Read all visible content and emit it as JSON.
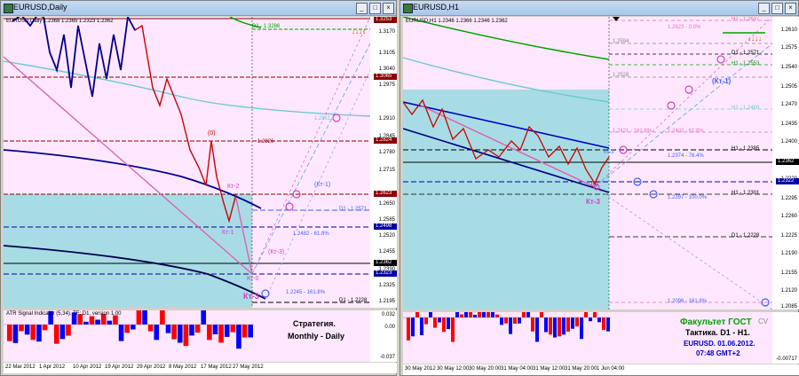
{
  "left_window": {
    "title": "EURUSD,Daily",
    "ohlc_label": "EURUSD,Daily  1.2368 1.2365 1.2323 1.2362",
    "price_ticks": [
      "1.3253",
      "1.3170",
      "1.3105",
      "1.3040",
      "1.2975",
      "1.2910",
      "1.2845",
      "1.2780",
      "1.2715",
      "1.2650",
      "1.2585",
      "1.2520",
      "1.2455",
      "1.2390",
      "1.2325",
      "1.2260",
      "1.2195"
    ],
    "price_boxes": {
      "top": "1.3253",
      "mid1": "1.3065",
      "mid2": "1.2824",
      "mid3": "1.2623",
      "blue1": "1.2498",
      "black": "1.2362",
      "bottom": "1.2323"
    },
    "labels": {
      "d1_top": "D1 - 1.3286",
      "d1_2571": "D1 - 1.2571",
      "d1_2228": "D1 - 1.2228",
      "fib_2482": "1.2482 - 61.8%",
      "fib_2245": "1.2245 - 161.8%",
      "lvl_1_2826": "1.2826",
      "lvl_1_2951": "1.2951",
      "zero": "(0)",
      "kt2": "Кт-2",
      "kt1": "Кт-1",
      "kt3": "(Кт-3)",
      "kt1b": "(Кт-1)",
      "kt0": "Кт-0",
      "kt3big": "Кт-3"
    },
    "indicator_label": "ATR Signal Indicator (5,34). TF: D1, version 1.00",
    "indicator_ticks": [
      "0.032",
      "0.00",
      "-0.037"
    ],
    "strategy_line1": "Стратегия.",
    "strategy_line2": "Monthly - Daily",
    "time_ticks": [
      "22 Mar 2012",
      "1 Apr 2012",
      "10 Apr 2012",
      "19 Apr 2012",
      "29 Apr 2012",
      "8 May 2012",
      "17 May 2012",
      "27 May 2012"
    ]
  },
  "right_window": {
    "title": "EURUSD,H1",
    "ohlc_label": "EURUSD,H1  1.2346 1.2366 1.2346 1.2362",
    "price_ticks": [
      "1.2610",
      "1.2575",
      "1.2540",
      "1.2505",
      "1.2470",
      "1.2435",
      "1.2400",
      "1.2365",
      "1.2330",
      "1.2295",
      "1.2260",
      "1.2225",
      "1.2190",
      "1.2155",
      "1.2120",
      "1.2085"
    ],
    "price_boxes": {
      "black": "1.2362",
      "blue": "1.2322"
    },
    "labels": {
      "h1_2637": "H1 - 1.2637",
      "fib_2623": "1.2623 - 0.0%",
      "lvl_2594": "1.2594",
      "d1_2571": "D1 - 1.2571",
      "h1_2553": "H1 - 1.2553",
      "lvl_2528": "1.2528",
      "h1_2469": "H1 - 1.2469",
      "fib_2421": "1.2421 - 161.8%",
      "fib_2402": "1.2402 - 61.8%",
      "h1_2385": "H1 - 1.2385",
      "fib_2374": "1.2374 - 76.4%",
      "h1_2301": "H1 - 1.2301",
      "fib_2297": "1.2297 - 100.0%",
      "d1_2228": "D1 - 1.2228",
      "fib_2096": "1.2096 - 161.8%",
      "kt1": "(Кт-1)",
      "kt3": "Кт-3",
      "zero": "(0)",
      "kt3small": "Кт-3"
    },
    "indicator_ticks": [
      "-0.00717"
    ],
    "footer_title": "Факультет ГОСТ",
    "footer_tag": "CV",
    "footer_tactic": "Тактика. D1 - H1.",
    "footer_date": "EURUSD. 01.06.2012.",
    "footer_time": "07:48  GMT+2",
    "time_ticks": [
      "30 May 2012",
      "30 May 12:00",
      "30 May 20:00",
      "31 May 04:00",
      "31 May 12:00",
      "31 May 20:00",
      "1 Jun 04:00"
    ]
  },
  "colors": {
    "candle": "#cc0000",
    "blue_line": "#000080",
    "cyan": "#66c0d0",
    "green": "#00a000",
    "pink": "#e060b0",
    "bg": "#ffe8ff",
    "zone": "#a0d8e0"
  }
}
